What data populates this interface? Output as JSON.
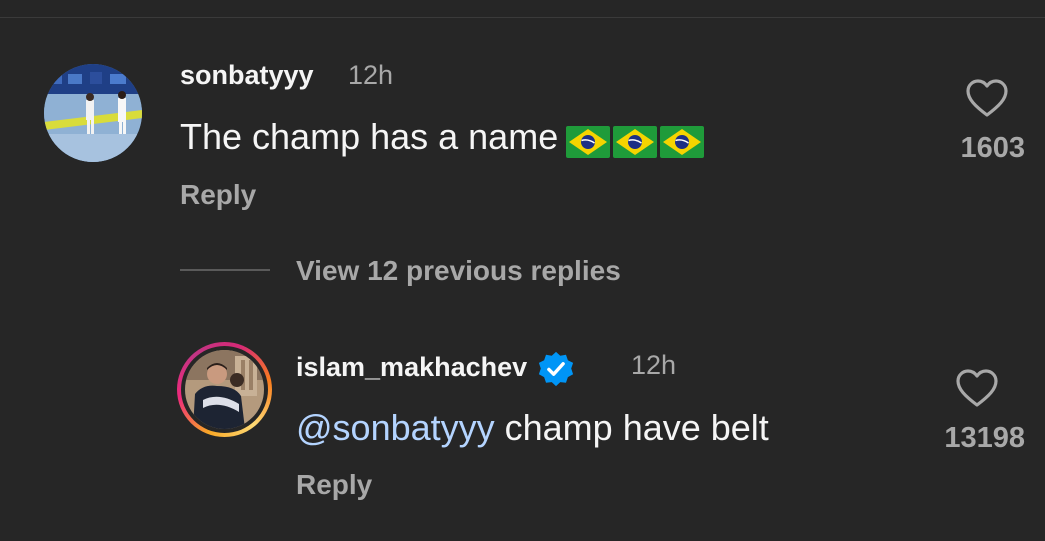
{
  "comments": [
    {
      "username": "sonbatyyy",
      "time": "12h",
      "text": "The champ has a name",
      "emoji": [
        "brazil-flag",
        "brazil-flag",
        "brazil-flag"
      ],
      "reply_label": "Reply",
      "like_count": "1603"
    }
  ],
  "view_replies_label": "View 12 previous replies",
  "reply": {
    "username": "islam_makhachev",
    "verified": true,
    "time": "12h",
    "mention": "@sonbatyyy",
    "text": " champ have belt",
    "reply_label": "Reply",
    "like_count": "13198"
  },
  "icons": {
    "heart": "heart-outline-icon",
    "verified": "verified-badge-icon",
    "flag": "brazil-flag-icon"
  },
  "colors": {
    "background": "#262626",
    "primary_text": "#f5f5f5",
    "secondary_text": "#a8a8a8",
    "mention": "#b4d4ff",
    "verified_blue": "#0095f6"
  }
}
